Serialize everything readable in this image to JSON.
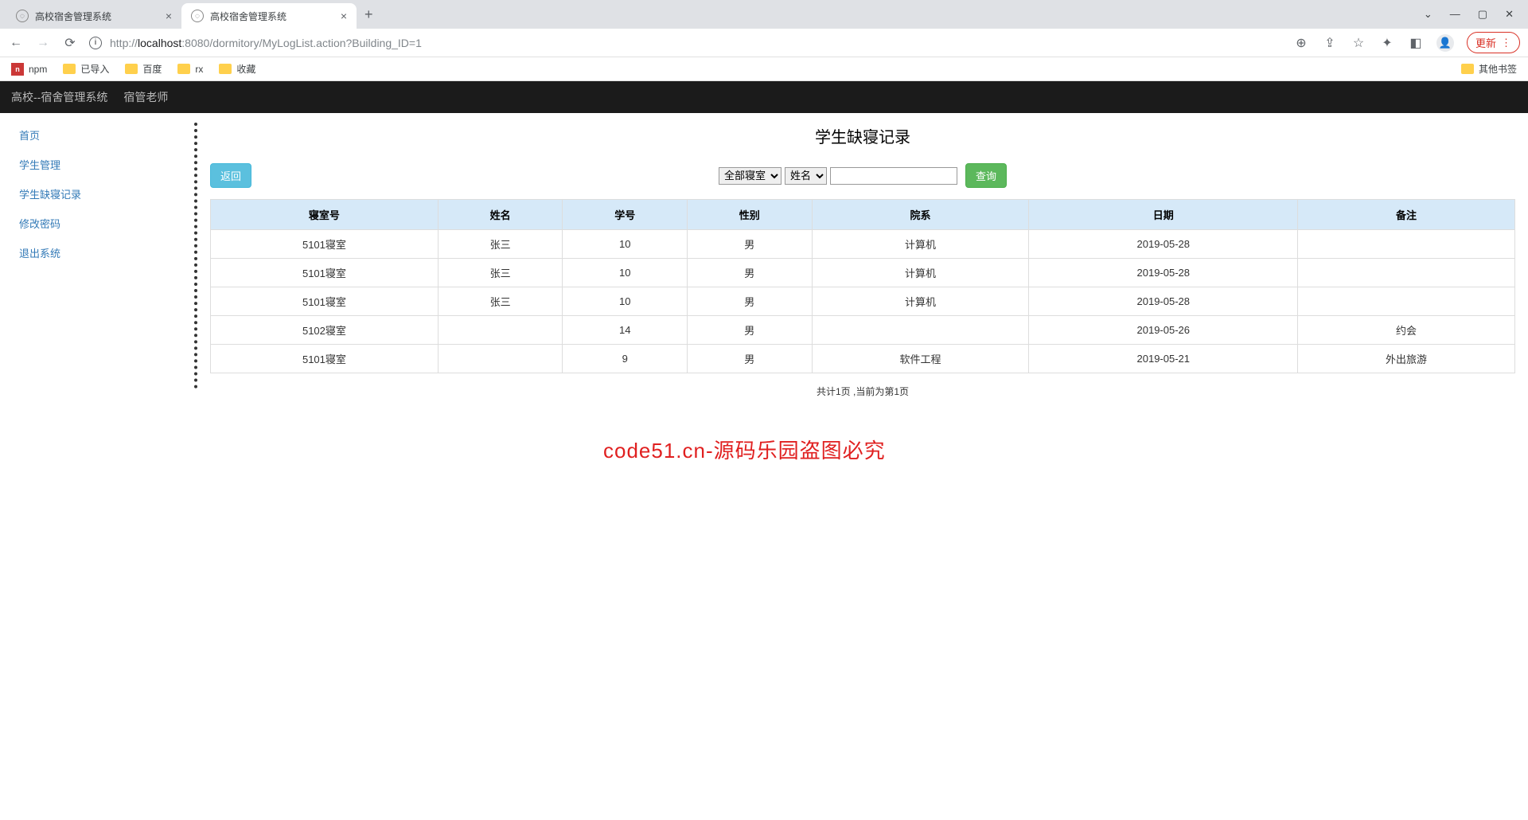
{
  "browser": {
    "tabs": [
      {
        "title": "高校宿舍管理系统"
      },
      {
        "title": "高校宿舍管理系统"
      }
    ],
    "url_protocol": "http://",
    "url_host": "localhost",
    "url_port": ":8080",
    "url_path": "/dormitory/MyLogList.action?Building_ID=1",
    "update_label": "更新",
    "bookmarks": {
      "npm": "npm",
      "imported": "已导入",
      "baidu": "百度",
      "rx": "rx",
      "fav": "收藏",
      "other": "其他书签"
    }
  },
  "topbar": {
    "brand": "高校--宿舍管理系统",
    "role": "宿管老师"
  },
  "sidebar": {
    "home": "首页",
    "student_manage": "学生管理",
    "absence_log": "学生缺寝记录",
    "change_pwd": "修改密码",
    "logout": "退出系统"
  },
  "main": {
    "title": "学生缺寝记录",
    "back_label": "返回",
    "dorm_select": "全部寝室",
    "field_select": "姓名",
    "search_label": "查询",
    "headers": {
      "dorm": "寝室号",
      "name": "姓名",
      "sid": "学号",
      "gender": "性别",
      "dept": "院系",
      "date": "日期",
      "remark": "备注"
    },
    "rows": [
      {
        "dorm": "5101寝室",
        "name": "张三",
        "sid": "10",
        "gender": "男",
        "dept": "计算机",
        "date": "2019-05-28",
        "remark": ""
      },
      {
        "dorm": "5101寝室",
        "name": "张三",
        "sid": "10",
        "gender": "男",
        "dept": "计算机",
        "date": "2019-05-28",
        "remark": ""
      },
      {
        "dorm": "5101寝室",
        "name": "张三",
        "sid": "10",
        "gender": "男",
        "dept": "计算机",
        "date": "2019-05-28",
        "remark": ""
      },
      {
        "dorm": "5102寝室",
        "name": "",
        "sid": "14",
        "gender": "男",
        "dept": "",
        "date": "2019-05-26",
        "remark": "约会"
      },
      {
        "dorm": "5101寝室",
        "name": "",
        "sid": "9",
        "gender": "男",
        "dept": "软件工程",
        "date": "2019-05-21",
        "remark": "外出旅游"
      }
    ],
    "pager": "共计1页 ,当前为第1页"
  },
  "watermark": "code51.cn-源码乐园盗图必究"
}
